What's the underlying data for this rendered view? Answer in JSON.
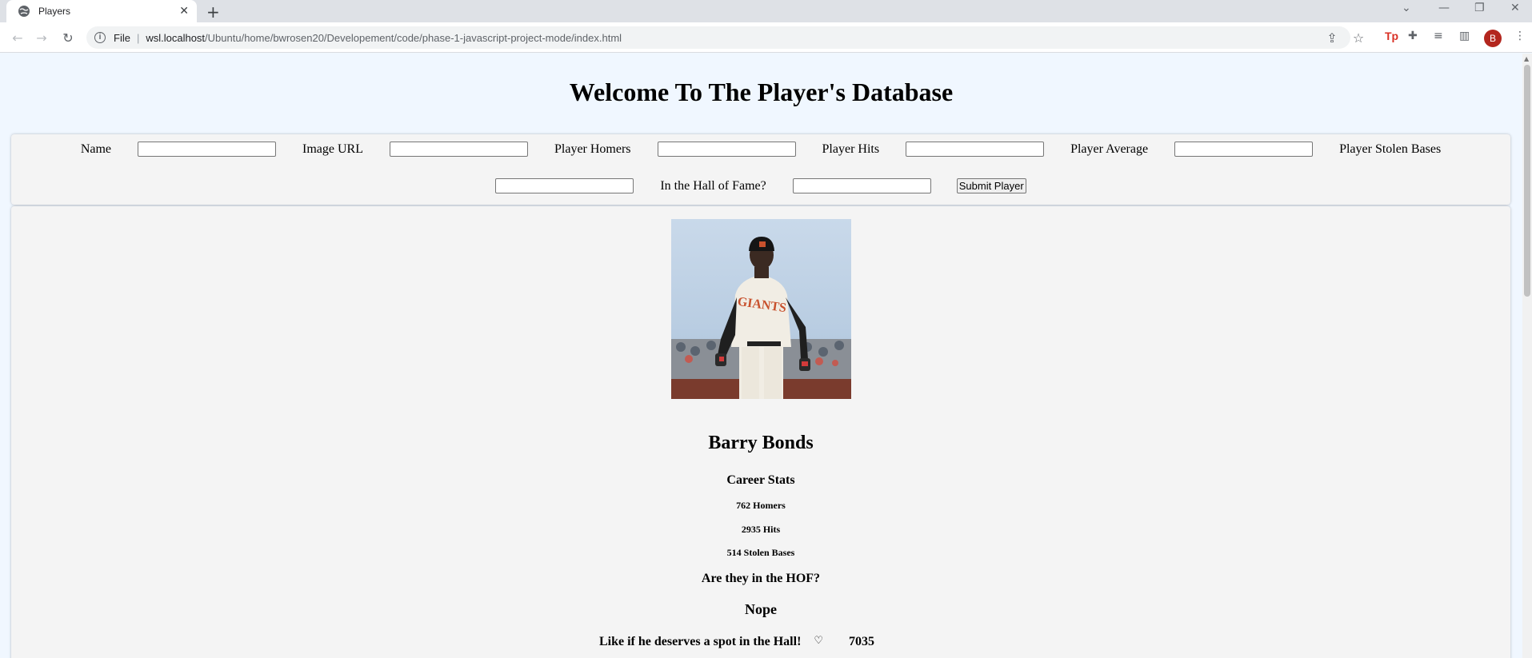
{
  "browser": {
    "tab_title": "Players",
    "new_tab": "+",
    "url_scheme": "File",
    "url_host": "wsl.localhost",
    "url_path": "/Ubuntu/home/bwrosen20/Developement/code/phase-1-javascript-project-mode/index.html",
    "ext_tp": "Tp",
    "profile_initial": "B"
  },
  "page": {
    "title": "Welcome To The Player's Database"
  },
  "form": {
    "name_label": "Name",
    "image_label": "Image URL",
    "homers_label": "Player Homers",
    "hits_label": "Player Hits",
    "average_label": "Player Average",
    "steals_label": "Player Stolen Bases",
    "hof_label": "In the Hall of Fame?",
    "submit_label": "Submit Player"
  },
  "player": {
    "name": "Barry Bonds",
    "career_stats_heading": "Career Stats",
    "homers": "762 Homers",
    "hits": "2935 Hits",
    "stolen_bases": "514 Stolen Bases",
    "hof_question": "Are they in the HOF?",
    "hof_answer": "Nope",
    "like_prompt": "Like if he deserves a spot in the Hall!",
    "like_icon": "♡",
    "like_count": "7035"
  },
  "colors": {
    "page_bg": "#f0f7ff",
    "panel_bg": "#f4f4f4",
    "jersey_orange": "#c8512d"
  }
}
